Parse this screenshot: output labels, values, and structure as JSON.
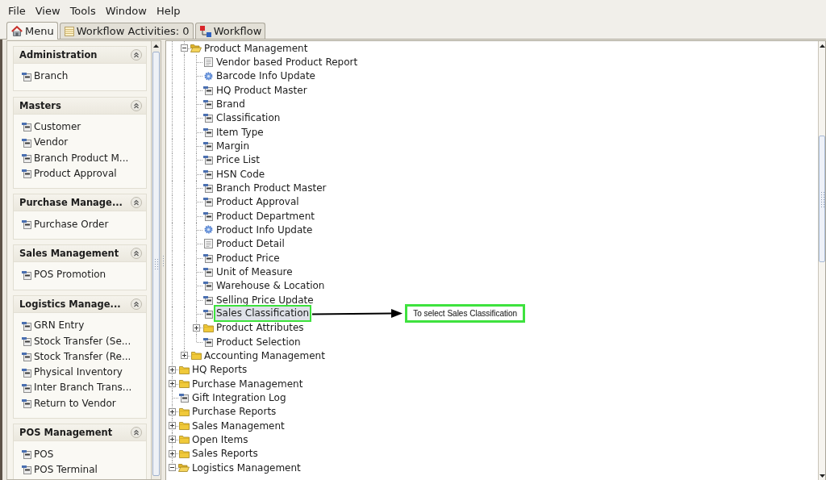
{
  "menu_bar": [
    "File",
    "View",
    "Tools",
    "Window",
    "Help"
  ],
  "tabs": [
    {
      "label": "Menu",
      "selected": true
    },
    {
      "label": "Workflow Activities: 0",
      "selected": false
    },
    {
      "label": "Workflow",
      "selected": false
    }
  ],
  "sidebar": {
    "groups": [
      {
        "title": "Administration",
        "expanded": true,
        "items": [
          "Branch"
        ]
      },
      {
        "title": "Masters",
        "expanded": true,
        "items": [
          "Customer",
          "Vendor",
          "Branch Product M...",
          "Product Approval"
        ]
      },
      {
        "title": "Purchase Manage...",
        "expanded": true,
        "items": [
          "Purchase Order"
        ]
      },
      {
        "title": "Sales Management",
        "expanded": true,
        "items": [
          "POS Promotion"
        ]
      },
      {
        "title": "Logistics Manage...",
        "expanded": true,
        "items": [
          "GRN Entry",
          "Stock Transfer (Se...",
          "Stock Transfer (Re...",
          "Physical Inventory",
          "Inter Branch Trans...",
          "Return to Vendor"
        ]
      },
      {
        "title": "POS Management",
        "expanded": true,
        "items": [
          "POS",
          "POS Terminal"
        ]
      }
    ]
  },
  "tree": {
    "items": [
      {
        "children": [
          {
            "label": "Product Management",
            "kind": "folder",
            "expanded": true,
            "selected": false,
            "children": [
              {
                "label": "Vendor based Product Report",
                "kind": "report",
                "selected": false
              },
              {
                "label": "Barcode Info Update",
                "kind": "process",
                "selected": false
              },
              {
                "label": "HQ Product Master",
                "kind": "window",
                "selected": false
              },
              {
                "label": "Brand",
                "kind": "window",
                "selected": false
              },
              {
                "label": "Classification",
                "kind": "window",
                "selected": false
              },
              {
                "label": "Item Type",
                "kind": "window",
                "selected": false
              },
              {
                "label": "Margin",
                "kind": "window",
                "selected": false
              },
              {
                "label": "Price List",
                "kind": "window",
                "selected": false
              },
              {
                "label": "HSN Code",
                "kind": "window",
                "selected": false
              },
              {
                "label": "Branch Product Master",
                "kind": "window",
                "selected": false
              },
              {
                "label": "Product Approval",
                "kind": "window",
                "selected": false
              },
              {
                "label": "Product Department",
                "kind": "window",
                "selected": false
              },
              {
                "label": "Product Info Update",
                "kind": "process",
                "selected": false
              },
              {
                "label": "Product Detail",
                "kind": "report",
                "selected": false
              },
              {
                "label": "Product Price",
                "kind": "window",
                "selected": false
              },
              {
                "label": "Unit of Measure",
                "kind": "window",
                "selected": false
              },
              {
                "label": "Warehouse & Location",
                "kind": "window",
                "selected": false
              },
              {
                "label": "Selling Price Update",
                "kind": "window",
                "selected": false
              },
              {
                "label": "Sales Classification",
                "kind": "window",
                "selected": true,
                "callout": "To select Sales Classification"
              },
              {
                "label": "Product Attributes",
                "kind": "folder",
                "expanded": false,
                "selected": false
              },
              {
                "label": "Product Selection",
                "kind": "window",
                "selected": false
              }
            ]
          },
          {
            "label": "Accounting Management",
            "kind": "folder",
            "expanded": false,
            "selected": false
          }
        ]
      },
      {
        "label": "HQ Reports",
        "kind": "folder",
        "expanded": false,
        "selected": false
      },
      {
        "label": "Purchase Management",
        "kind": "folder",
        "expanded": false,
        "selected": false
      },
      {
        "label": "Gift Integration Log",
        "kind": "window",
        "selected": false
      },
      {
        "label": "Purchase Reports",
        "kind": "folder",
        "expanded": false,
        "selected": false
      },
      {
        "label": "Sales Management",
        "kind": "folder",
        "expanded": false,
        "selected": false
      },
      {
        "label": "Open Items",
        "kind": "folder",
        "expanded": false,
        "selected": false
      },
      {
        "label": "Sales Reports",
        "kind": "folder",
        "expanded": false,
        "selected": false
      },
      {
        "label": "Logistics Management",
        "kind": "folder",
        "expanded": true,
        "selected": false
      }
    ]
  }
}
